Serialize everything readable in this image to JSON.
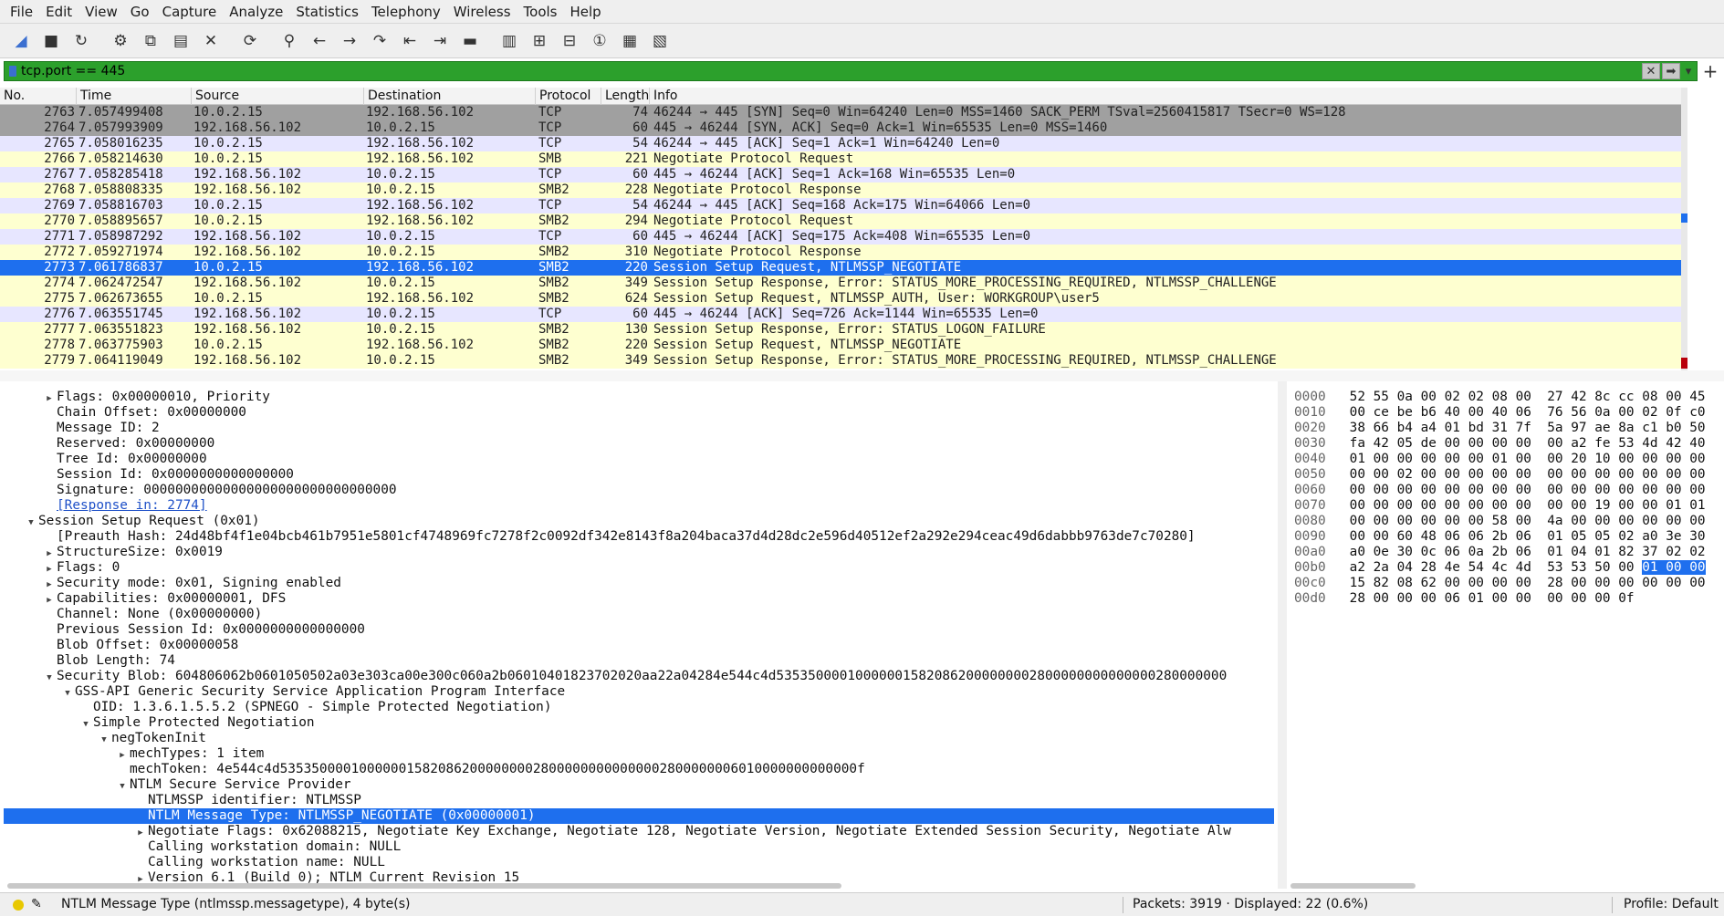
{
  "menubar": [
    "File",
    "Edit",
    "View",
    "Go",
    "Capture",
    "Analyze",
    "Statistics",
    "Telephony",
    "Wireless",
    "Tools",
    "Help"
  ],
  "toolbar": {
    "icons": [
      "shark-fin-start-icon",
      "stop-square-icon",
      "restart-fin-icon",
      "capture-options-gear-icon",
      "open-file-icon",
      "save-file-icon",
      "close-file-icon",
      "reload-file-icon",
      "find-packet-icon",
      "go-back-arrow-icon",
      "go-forward-arrow-icon",
      "go-to-packet-icon",
      "go-first-packet-icon",
      "go-last-packet-icon",
      "auto-scroll-icon",
      "colorize-icon",
      "zoom-in-icon",
      "zoom-out-icon",
      "normal-size-icon",
      "resize-columns-icon",
      "resize-layout-icon"
    ]
  },
  "filter": {
    "value": "tcp.port == 445",
    "accent": "#2ca02c"
  },
  "columns": {
    "no": "No.",
    "time": "Time",
    "source": "Source",
    "destination": "Destination",
    "protocol": "Protocol",
    "length": "Length",
    "info": "Info"
  },
  "packets": [
    {
      "no": "2763",
      "time": "7.057499408",
      "src": "10.0.2.15",
      "dst": "192.168.56.102",
      "proto": "TCP",
      "len": "74",
      "info": "46244 → 445 [SYN] Seq=0 Win=64240 Len=0 MSS=1460 SACK_PERM TSval=2560415817 TSecr=0 WS=128",
      "style": "bg-tcp-gray"
    },
    {
      "no": "2764",
      "time": "7.057993909",
      "src": "192.168.56.102",
      "dst": "10.0.2.15",
      "proto": "TCP",
      "len": "60",
      "info": "445 → 46244 [SYN, ACK] Seq=0 Ack=1 Win=65535 Len=0 MSS=1460",
      "style": "bg-tcp-gray"
    },
    {
      "no": "2765",
      "time": "7.058016235",
      "src": "10.0.2.15",
      "dst": "192.168.56.102",
      "proto": "TCP",
      "len": "54",
      "info": "46244 → 445 [ACK] Seq=1 Ack=1 Win=64240 Len=0",
      "style": "bg-tcp"
    },
    {
      "no": "2766",
      "time": "7.058214630",
      "src": "10.0.2.15",
      "dst": "192.168.56.102",
      "proto": "SMB",
      "len": "221",
      "info": "Negotiate Protocol Request",
      "style": "bg-smb"
    },
    {
      "no": "2767",
      "time": "7.058285418",
      "src": "192.168.56.102",
      "dst": "10.0.2.15",
      "proto": "TCP",
      "len": "60",
      "info": "445 → 46244 [ACK] Seq=1 Ack=168 Win=65535 Len=0",
      "style": "bg-tcp"
    },
    {
      "no": "2768",
      "time": "7.058808335",
      "src": "192.168.56.102",
      "dst": "10.0.2.15",
      "proto": "SMB2",
      "len": "228",
      "info": "Negotiate Protocol Response",
      "style": "bg-smb"
    },
    {
      "no": "2769",
      "time": "7.058816703",
      "src": "10.0.2.15",
      "dst": "192.168.56.102",
      "proto": "TCP",
      "len": "54",
      "info": "46244 → 445 [ACK] Seq=168 Ack=175 Win=64066 Len=0",
      "style": "bg-tcp"
    },
    {
      "no": "2770",
      "time": "7.058895657",
      "src": "10.0.2.15",
      "dst": "192.168.56.102",
      "proto": "SMB2",
      "len": "294",
      "info": "Negotiate Protocol Request",
      "style": "bg-smb"
    },
    {
      "no": "2771",
      "time": "7.058987292",
      "src": "192.168.56.102",
      "dst": "10.0.2.15",
      "proto": "TCP",
      "len": "60",
      "info": "445 → 46244 [ACK] Seq=175 Ack=408 Win=65535 Len=0",
      "style": "bg-tcp"
    },
    {
      "no": "2772",
      "time": "7.059271974",
      "src": "192.168.56.102",
      "dst": "10.0.2.15",
      "proto": "SMB2",
      "len": "310",
      "info": "Negotiate Protocol Response",
      "style": "bg-smb"
    },
    {
      "no": "2773",
      "time": "7.061786837",
      "src": "10.0.2.15",
      "dst": "192.168.56.102",
      "proto": "SMB2",
      "len": "220",
      "info": "Session Setup Request, NTLMSSP_NEGOTIATE",
      "style": "bg-sel"
    },
    {
      "no": "2774",
      "time": "7.062472547",
      "src": "192.168.56.102",
      "dst": "10.0.2.15",
      "proto": "SMB2",
      "len": "349",
      "info": "Session Setup Response, Error: STATUS_MORE_PROCESSING_REQUIRED, NTLMSSP_CHALLENGE",
      "style": "bg-smb"
    },
    {
      "no": "2775",
      "time": "7.062673655",
      "src": "10.0.2.15",
      "dst": "192.168.56.102",
      "proto": "SMB2",
      "len": "624",
      "info": "Session Setup Request, NTLMSSP_AUTH, User: WORKGROUP\\user5",
      "style": "bg-smb"
    },
    {
      "no": "2776",
      "time": "7.063551745",
      "src": "192.168.56.102",
      "dst": "10.0.2.15",
      "proto": "TCP",
      "len": "60",
      "info": "445 → 46244 [ACK] Seq=726 Ack=1144 Win=65535 Len=0",
      "style": "bg-tcp"
    },
    {
      "no": "2777",
      "time": "7.063551823",
      "src": "192.168.56.102",
      "dst": "10.0.2.15",
      "proto": "SMB2",
      "len": "130",
      "info": "Session Setup Response, Error: STATUS_LOGON_FAILURE",
      "style": "bg-smb"
    },
    {
      "no": "2778",
      "time": "7.063775903",
      "src": "10.0.2.15",
      "dst": "192.168.56.102",
      "proto": "SMB2",
      "len": "220",
      "info": "Session Setup Request, NTLMSSP_NEGOTIATE",
      "style": "bg-smb"
    },
    {
      "no": "2779",
      "time": "7.064119049",
      "src": "192.168.56.102",
      "dst": "10.0.2.15",
      "proto": "SMB2",
      "len": "349",
      "info": "Session Setup Response, Error: STATUS_MORE_PROCESSING_REQUIRED, NTLMSSP_CHALLENGE",
      "style": "bg-smb"
    }
  ],
  "details": [
    {
      "depth": 2,
      "tri": "closed",
      "text": "Flags: 0x00000010, Priority"
    },
    {
      "depth": 2,
      "tri": "none",
      "text": "Chain Offset: 0x00000000"
    },
    {
      "depth": 2,
      "tri": "none",
      "text": "Message ID: 2"
    },
    {
      "depth": 2,
      "tri": "none",
      "text": "Reserved: 0x00000000"
    },
    {
      "depth": 2,
      "tri": "none",
      "text": "Tree Id: 0x00000000"
    },
    {
      "depth": 2,
      "tri": "none",
      "text": "Session Id: 0x0000000000000000"
    },
    {
      "depth": 2,
      "tri": "none",
      "text": "Signature: 00000000000000000000000000000000"
    },
    {
      "depth": 2,
      "tri": "none",
      "text": "[Response in: 2774]",
      "link": true
    },
    {
      "depth": 1,
      "tri": "open",
      "text": "Session Setup Request (0x01)"
    },
    {
      "depth": 2,
      "tri": "none",
      "text": "[Preauth Hash: 24d48bf4f1e04bcb461b7951e5801cf4748969fc7278f2c0092df342e8143f8a204baca37d4d28dc2e596d40512ef2a292e294ceac49d6dabbb9763de7c70280]"
    },
    {
      "depth": 2,
      "tri": "closed",
      "text": "StructureSize: 0x0019"
    },
    {
      "depth": 2,
      "tri": "closed",
      "text": "Flags: 0"
    },
    {
      "depth": 2,
      "tri": "closed",
      "text": "Security mode: 0x01, Signing enabled"
    },
    {
      "depth": 2,
      "tri": "closed",
      "text": "Capabilities: 0x00000001, DFS"
    },
    {
      "depth": 2,
      "tri": "none",
      "text": "Channel: None (0x00000000)"
    },
    {
      "depth": 2,
      "tri": "none",
      "text": "Previous Session Id: 0x0000000000000000"
    },
    {
      "depth": 2,
      "tri": "none",
      "text": "Blob Offset: 0x00000058"
    },
    {
      "depth": 2,
      "tri": "none",
      "text": "Blob Length: 74"
    },
    {
      "depth": 2,
      "tri": "open",
      "text": "Security Blob: 604806062b0601050502a03e303ca00e300c060a2b06010401823702020aa22a04284e544c4d535350000100000015820862000000002800000000000000280000000"
    },
    {
      "depth": 3,
      "tri": "open",
      "text": "GSS-API Generic Security Service Application Program Interface"
    },
    {
      "depth": 4,
      "tri": "none",
      "text": "OID: 1.3.6.1.5.5.2 (SPNEGO - Simple Protected Negotiation)"
    },
    {
      "depth": 4,
      "tri": "open",
      "text": "Simple Protected Negotiation"
    },
    {
      "depth": 5,
      "tri": "open",
      "text": "negTokenInit"
    },
    {
      "depth": 6,
      "tri": "closed",
      "text": "mechTypes: 1 item"
    },
    {
      "depth": 6,
      "tri": "none",
      "text": "mechToken: 4e544c4d5353500001000000158208620000000028000000000000002800000006010000000000000f"
    },
    {
      "depth": 6,
      "tri": "open",
      "text": "NTLM Secure Service Provider"
    },
    {
      "depth": 7,
      "tri": "none",
      "text": "NTLMSSP identifier: NTLMSSP"
    },
    {
      "depth": 7,
      "tri": "none",
      "text": "NTLM Message Type: NTLMSSP_NEGOTIATE (0x00000001)",
      "sel": true
    },
    {
      "depth": 7,
      "tri": "closed",
      "text": "Negotiate Flags: 0x62088215, Negotiate Key Exchange, Negotiate 128, Negotiate Version, Negotiate Extended Session Security, Negotiate Alw"
    },
    {
      "depth": 7,
      "tri": "none",
      "text": "Calling workstation domain: NULL"
    },
    {
      "depth": 7,
      "tri": "none",
      "text": "Calling workstation name: NULL"
    },
    {
      "depth": 7,
      "tri": "closed",
      "text": "Version 6.1 (Build 0); NTLM Current Revision 15"
    }
  ],
  "bytes": [
    {
      "off": "0000",
      "hex": "52 55 0a 00 02 02 08 00  27 42 8c cc 08 00 45"
    },
    {
      "off": "0010",
      "hex": "00 ce be b6 40 00 40 06  76 56 0a 00 02 0f c0"
    },
    {
      "off": "0020",
      "hex": "38 66 b4 a4 01 bd 31 7f  5a 97 ae 8a c1 b0 50"
    },
    {
      "off": "0030",
      "hex": "fa 42 05 de 00 00 00 00  00 a2 fe 53 4d 42 40"
    },
    {
      "off": "0040",
      "hex": "01 00 00 00 00 00 01 00  00 20 10 00 00 00 00"
    },
    {
      "off": "0050",
      "hex": "00 00 02 00 00 00 00 00  00 00 00 00 00 00 00"
    },
    {
      "off": "0060",
      "hex": "00 00 00 00 00 00 00 00  00 00 00 00 00 00 00"
    },
    {
      "off": "0070",
      "hex": "00 00 00 00 00 00 00 00  00 00 19 00 00 01 01"
    },
    {
      "off": "0080",
      "hex": "00 00 00 00 00 00 58 00  4a 00 00 00 00 00 00"
    },
    {
      "off": "0090",
      "hex": "00 00 60 48 06 06 2b 06  01 05 05 02 a0 3e 30"
    },
    {
      "off": "00a0",
      "hex": "a0 0e 30 0c 06 0a 2b 06  01 04 01 82 37 02 02"
    },
    {
      "off": "00b0",
      "hex": "a2 2a 04 28 4e 54 4c 4d  53 53 50 00 ",
      "hl": "01 00 00"
    },
    {
      "off": "00c0",
      "hex": "15 82 08 62 00 00 00 00  28 00 00 00 00 00 00"
    },
    {
      "off": "00d0",
      "hex": "28 00 00 00 06 01 00 00  00 00 00 0f"
    }
  ],
  "status": {
    "field": "NTLM Message Type (ntlmssp.messagetype), 4 byte(s)",
    "packets": "Packets: 3919 · Displayed: 22 (0.6%)",
    "profile": "Profile: Default"
  }
}
